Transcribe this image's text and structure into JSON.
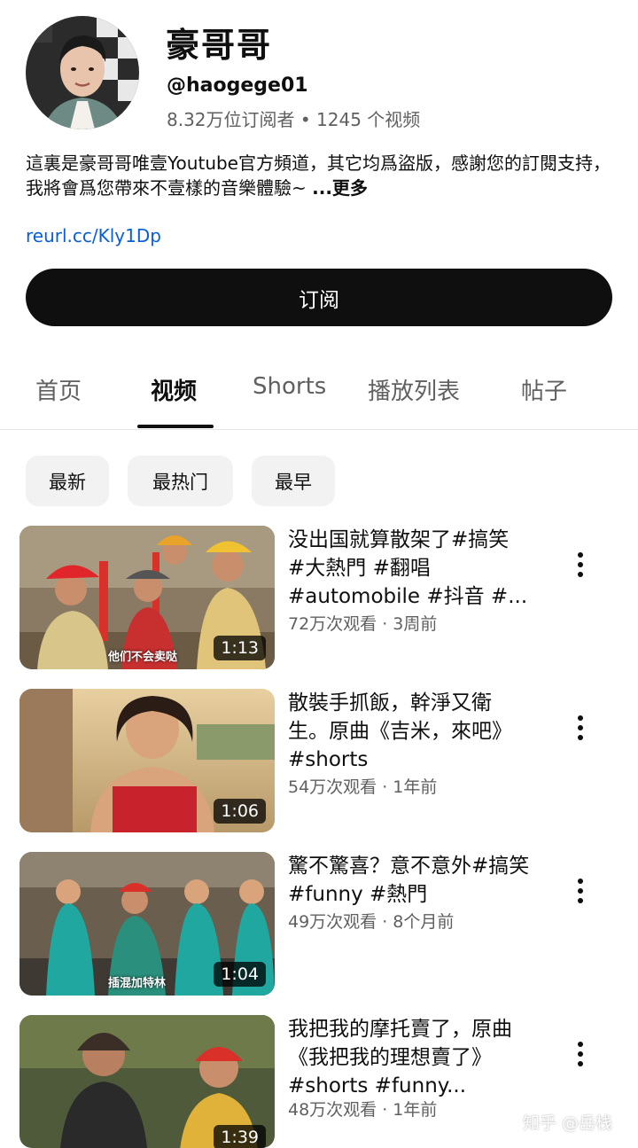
{
  "channel": {
    "name": "豪哥哥",
    "handle": "@haogege01",
    "stats": "8.32万位订阅者 • 1245 个视频",
    "description": "這裏是豪哥哥唯壹Youtube官方頻道，其它均爲盜版，感謝您的訂閱支持，我將會爲您帶來不壹樣的音樂體驗~ ",
    "more_label": "...更多",
    "link": "reurl.cc/Kly1Dp",
    "subscribe_label": "订阅"
  },
  "tabs": [
    {
      "label": "首页"
    },
    {
      "label": "视频"
    },
    {
      "label": "Shorts"
    },
    {
      "label": "播放列表"
    },
    {
      "label": "帖子"
    }
  ],
  "active_tab": "视频",
  "filters": [
    {
      "label": "最新"
    },
    {
      "label": "最热门"
    },
    {
      "label": "最早"
    }
  ],
  "videos": [
    {
      "title": "没出国就算散架了#搞笑 #大熱門 #翻唱 #automobile #抖音 #...",
      "meta": "72万次观看 · 3周前",
      "duration": "1:13",
      "caption": "他们不会卖哒"
    },
    {
      "title": "散裝手抓飯，幹淨又衛生。原曲《吉米，來吧》#shorts",
      "meta": "54万次观看 · 1年前",
      "duration": "1:06",
      "caption": ""
    },
    {
      "title": "驚不驚喜？意不意外#搞笑 #funny #熱門",
      "meta": "49万次观看 · 8个月前",
      "duration": "1:04",
      "caption": "插混加特林"
    },
    {
      "title": "我把我的摩托賣了，原曲《我把我的理想賣了》#shorts #funny...",
      "meta": "48万次观看 · 1年前",
      "duration": "1:39",
      "caption": ""
    }
  ],
  "watermark": "知乎 @岳栈",
  "colors": {
    "primary_text": "#0f0f0f",
    "secondary_text": "#606060",
    "link": "#065fd4",
    "chip_bg": "#f2f2f2"
  }
}
